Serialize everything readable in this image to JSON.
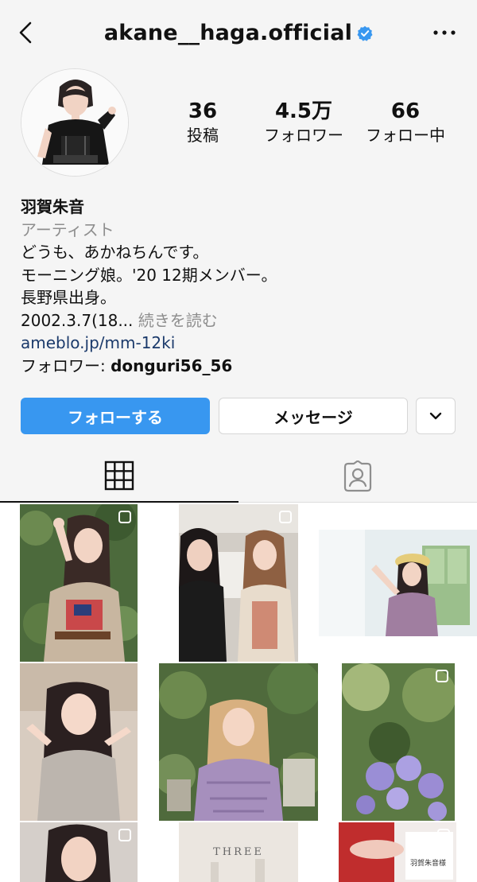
{
  "header": {
    "username": "akane__haga.official"
  },
  "stats": [
    {
      "value": "36",
      "label": "投稿"
    },
    {
      "value": "4.5万",
      "label": "フォロワー"
    },
    {
      "value": "66",
      "label": "フォロー中"
    }
  ],
  "bio": {
    "name": "羽賀朱音",
    "category": "アーティスト",
    "line1": "どうも、あかねちんです。",
    "line2": "モーニング娘。'20 12期メンバー。",
    "line3": "長野県出身。",
    "line4": "2002.3.7(18...",
    "more": "続きを読む",
    "link": "ameblo.jp/mm-12ki",
    "followed_prefix": "フォロワー: ",
    "followed_by": "donguri56_56"
  },
  "buttons": {
    "follow": "フォローする",
    "message": "メッセージ"
  },
  "photo_text": {
    "three": "THREE",
    "name_card": "羽賀朱音様"
  }
}
